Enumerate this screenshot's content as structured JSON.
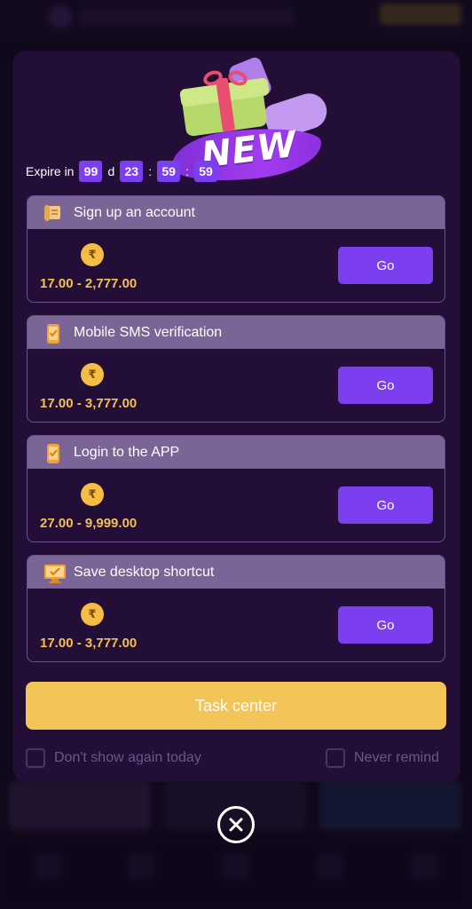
{
  "badge": {
    "new_label": "NEW"
  },
  "expire": {
    "label": "Expire in",
    "days": "99",
    "day_unit": "d",
    "hours": "23",
    "minutes": "59",
    "seconds": "59",
    "separator": ":"
  },
  "tasks": [
    {
      "title": "Sign up an account",
      "currency": "₹",
      "amount": "17.00 - 2,777.00",
      "button": "Go",
      "icon": "scroll-icon"
    },
    {
      "title": "Mobile SMS verification",
      "currency": "₹",
      "amount": "17.00 - 3,777.00",
      "button": "Go",
      "icon": "phone-check-icon"
    },
    {
      "title": "Login to the APP",
      "currency": "₹",
      "amount": "27.00 - 9,999.00",
      "button": "Go",
      "icon": "phone-check-icon"
    },
    {
      "title": "Save desktop shortcut",
      "currency": "₹",
      "amount": "17.00 - 3,777.00",
      "button": "Go",
      "icon": "desktop-check-icon"
    }
  ],
  "task_center": {
    "label": "Task center"
  },
  "options": {
    "dont_show_today": "Don't show again today",
    "never_remind": "Never remind"
  },
  "colors": {
    "accent": "#7b3ff0",
    "gold": "#f3c457",
    "modal_bg": "#230e38",
    "card_header": "#7a6596"
  }
}
